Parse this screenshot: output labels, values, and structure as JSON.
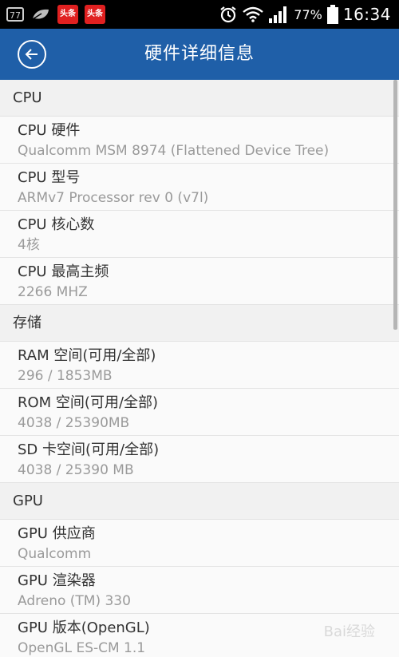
{
  "status_bar": {
    "badge_text": "77",
    "news_app_label": "头条",
    "battery_percent": "77%",
    "time": "16:34"
  },
  "header": {
    "title": "硬件详细信息"
  },
  "sections": [
    {
      "title": "CPU",
      "items": [
        {
          "label": "CPU 硬件",
          "value": "Qualcomm MSM 8974 (Flattened Device Tree)"
        },
        {
          "label": "CPU 型号",
          "value": "ARMv7 Processor rev 0 (v7l)"
        },
        {
          "label": "CPU 核心数",
          "value": "4核"
        },
        {
          "label": "CPU 最高主频",
          "value": "2266 MHZ"
        }
      ]
    },
    {
      "title": "存储",
      "items": [
        {
          "label": "RAM 空间(可用/全部)",
          "value": "296 / 1853MB"
        },
        {
          "label": "ROM 空间(可用/全部)",
          "value": "4038 / 25390MB"
        },
        {
          "label": "SD 卡空间(可用/全部)",
          "value": "4038 / 25390 MB"
        }
      ]
    },
    {
      "title": "GPU",
      "items": [
        {
          "label": "GPU 供应商",
          "value": "Qualcomm"
        },
        {
          "label": "GPU 渲染器",
          "value": "Adreno (TM) 330"
        },
        {
          "label": "GPU 版本(OpenGL)",
          "value": "OpenGL ES-CM 1.1"
        }
      ]
    }
  ],
  "watermark": "Bai经验",
  "colors": {
    "header_bg": "#1f5fa8",
    "status_bg": "#000000",
    "news_red": "#e02020"
  }
}
